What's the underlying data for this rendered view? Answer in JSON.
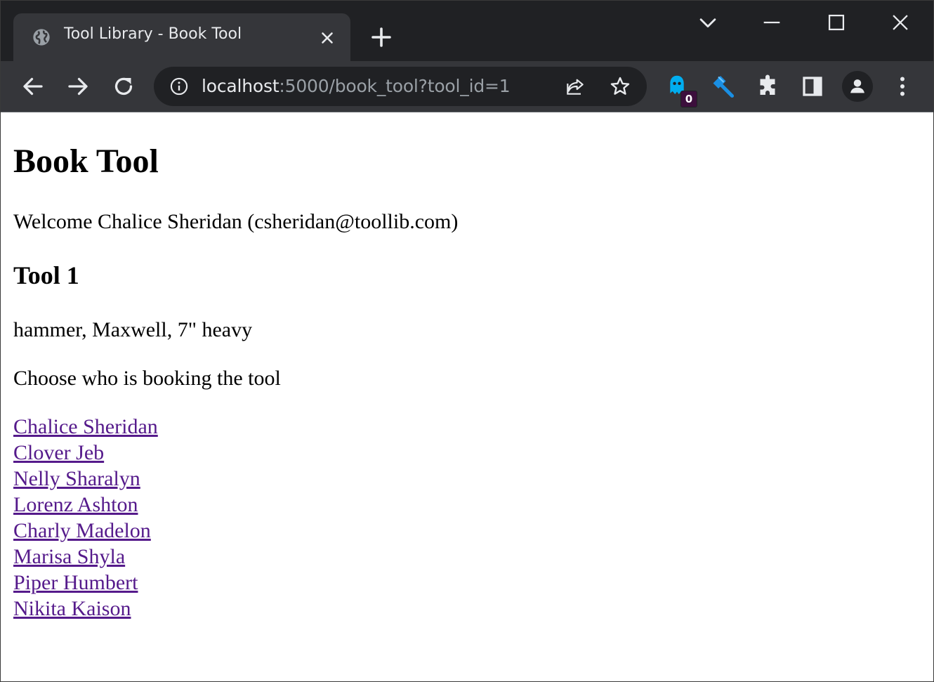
{
  "browser": {
    "tab": {
      "title": "Tool Library - Book Tool"
    },
    "address_bar": {
      "host": "localhost",
      "rest": ":5000/book_tool?tool_id=1"
    },
    "extension_badge": "0",
    "icons": {
      "tab_favicon": "globe-icon",
      "tab_close": "close-icon",
      "new_tab": "plus-icon",
      "tab_search": "chevron-down-icon",
      "minimize": "minimize-icon",
      "maximize": "maximize-icon",
      "close_window": "close-icon",
      "back": "arrow-left-icon",
      "forward": "arrow-right-icon",
      "reload": "reload-icon",
      "site_info": "info-icon",
      "share": "share-icon",
      "bookmark": "star-icon",
      "ghostery": "ghost-icon",
      "devtools_ext": "hammer-icon",
      "extensions": "puzzle-icon",
      "side_panel": "side-panel-icon",
      "profile": "person-icon",
      "menu": "kebab-menu-icon"
    },
    "colors": {
      "titlebar": "#202124",
      "toolbar": "#35363a",
      "link_visited": "#551a8b",
      "ghostery_blue": "#00aef0",
      "hammer_blue": "#1a8fe3"
    }
  },
  "page": {
    "title": "Book Tool",
    "welcome": "Welcome Chalice Sheridan (csheridan@toollib.com)",
    "tool_heading": "Tool 1",
    "tool_description": "hammer, Maxwell, 7\" heavy",
    "choose_prompt": "Choose who is booking the tool",
    "people": [
      "Chalice Sheridan",
      "Clover Jeb",
      "Nelly Sharalyn",
      "Lorenz Ashton",
      "Charly Madelon",
      "Marisa Shyla",
      "Piper Humbert",
      "Nikita Kaison"
    ]
  }
}
